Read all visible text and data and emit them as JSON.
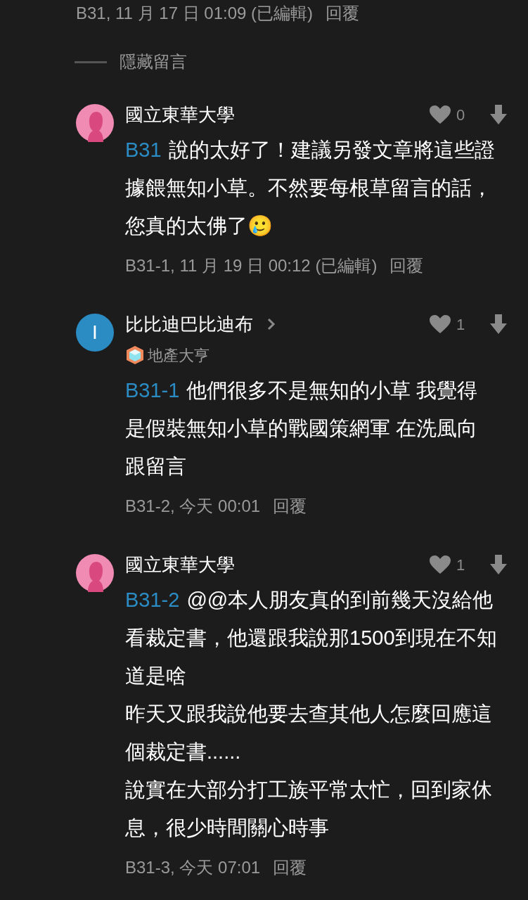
{
  "top_meta": {
    "info": "B31, 11 月 17 日 01:09 (已編輯)",
    "reply": "回覆"
  },
  "hidden_toggle": {
    "label": "隱藏留言"
  },
  "comments": [
    {
      "avatar": {
        "kind": "silhouette"
      },
      "name": "國立東華大學",
      "has_chevron": false,
      "likes": "0",
      "mention": "B31",
      "paragraphs": [
        "說的太好了！建議另發文章將這些證據餵無知小草。不然要每根草留言的話，您真的太佛了🥲"
      ],
      "info": "B31-1, 11 月 19 日 00:12 (已編輯)",
      "reply": "回覆"
    },
    {
      "avatar": {
        "kind": "letter",
        "letter": "I"
      },
      "name": "比比迪巴比迪布",
      "has_chevron": true,
      "badge": "地產大亨",
      "likes": "1",
      "mention": "B31-1",
      "paragraphs": [
        "他們很多不是無知的小草 我覺得是假裝無知小草的戰國策網軍 在洗風向跟留言"
      ],
      "info": "B31-2, 今天 00:01",
      "reply": "回覆"
    },
    {
      "avatar": {
        "kind": "silhouette"
      },
      "name": "國立東華大學",
      "has_chevron": false,
      "likes": "1",
      "mention": "B31-2",
      "paragraphs": [
        "@@本人朋友真的到前幾天沒給他看裁定書，他還跟我說那1500到現在不知道是啥",
        "昨天又跟我說他要去查其他人怎麼回應這個裁定書......",
        "說實在大部分打工族平常太忙，回到家休息，很少時間關心時事"
      ],
      "info": "B31-3, 今天 07:01",
      "reply": "回覆"
    }
  ]
}
